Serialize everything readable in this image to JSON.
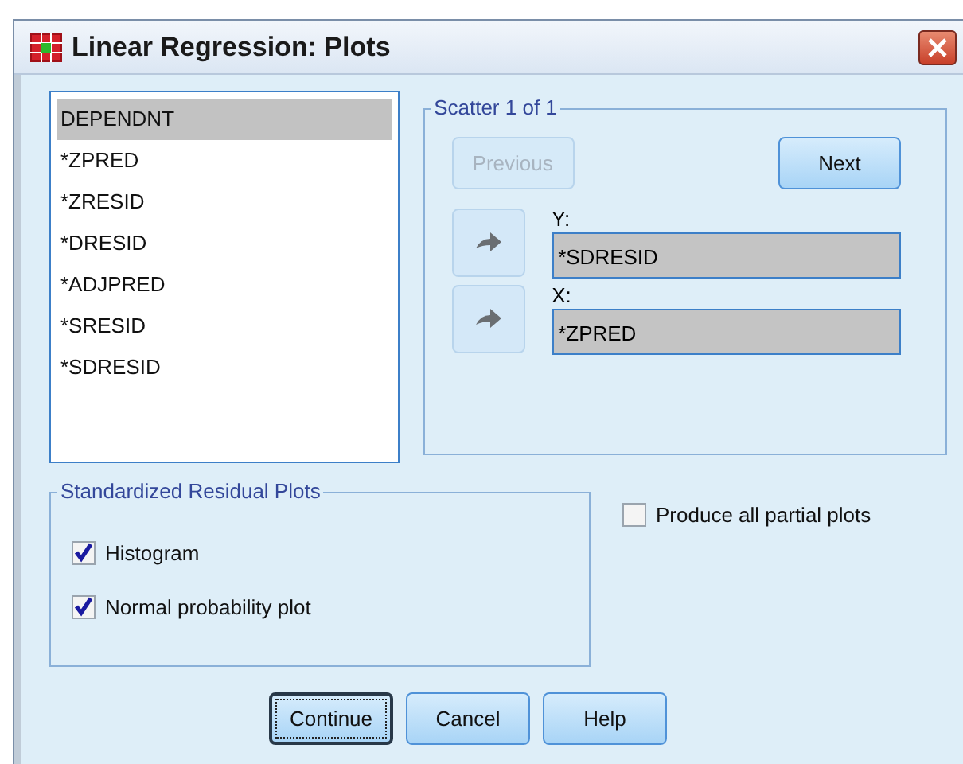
{
  "window": {
    "title": "Linear Regression: Plots"
  },
  "variables": [
    {
      "label": "DEPENDNT",
      "selected": true
    },
    {
      "label": "*ZPRED",
      "selected": false
    },
    {
      "label": "*ZRESID",
      "selected": false
    },
    {
      "label": "*DRESID",
      "selected": false
    },
    {
      "label": "*ADJPRED",
      "selected": false
    },
    {
      "label": "*SRESID",
      "selected": false
    },
    {
      "label": "*SDRESID",
      "selected": false
    }
  ],
  "scatter": {
    "title": "Scatter 1 of 1",
    "previous": {
      "label": "Previous",
      "disabled": true
    },
    "next": {
      "label": "Next",
      "disabled": false
    },
    "fields": [
      {
        "label": "Y:",
        "value": "*SDRESID"
      },
      {
        "label": "X:",
        "value": "*ZPRED"
      }
    ]
  },
  "residual_plots": {
    "title": "Standardized Residual Plots",
    "options": [
      {
        "label": "Histogram",
        "checked": true
      },
      {
        "label": "Normal probability plot",
        "checked": true
      }
    ]
  },
  "partial_plots": {
    "label": "Produce all partial plots",
    "checked": false
  },
  "buttons": [
    {
      "label": "Continue",
      "focused": true
    },
    {
      "label": "Cancel",
      "focused": false
    },
    {
      "label": "Help",
      "focused": false
    }
  ]
}
